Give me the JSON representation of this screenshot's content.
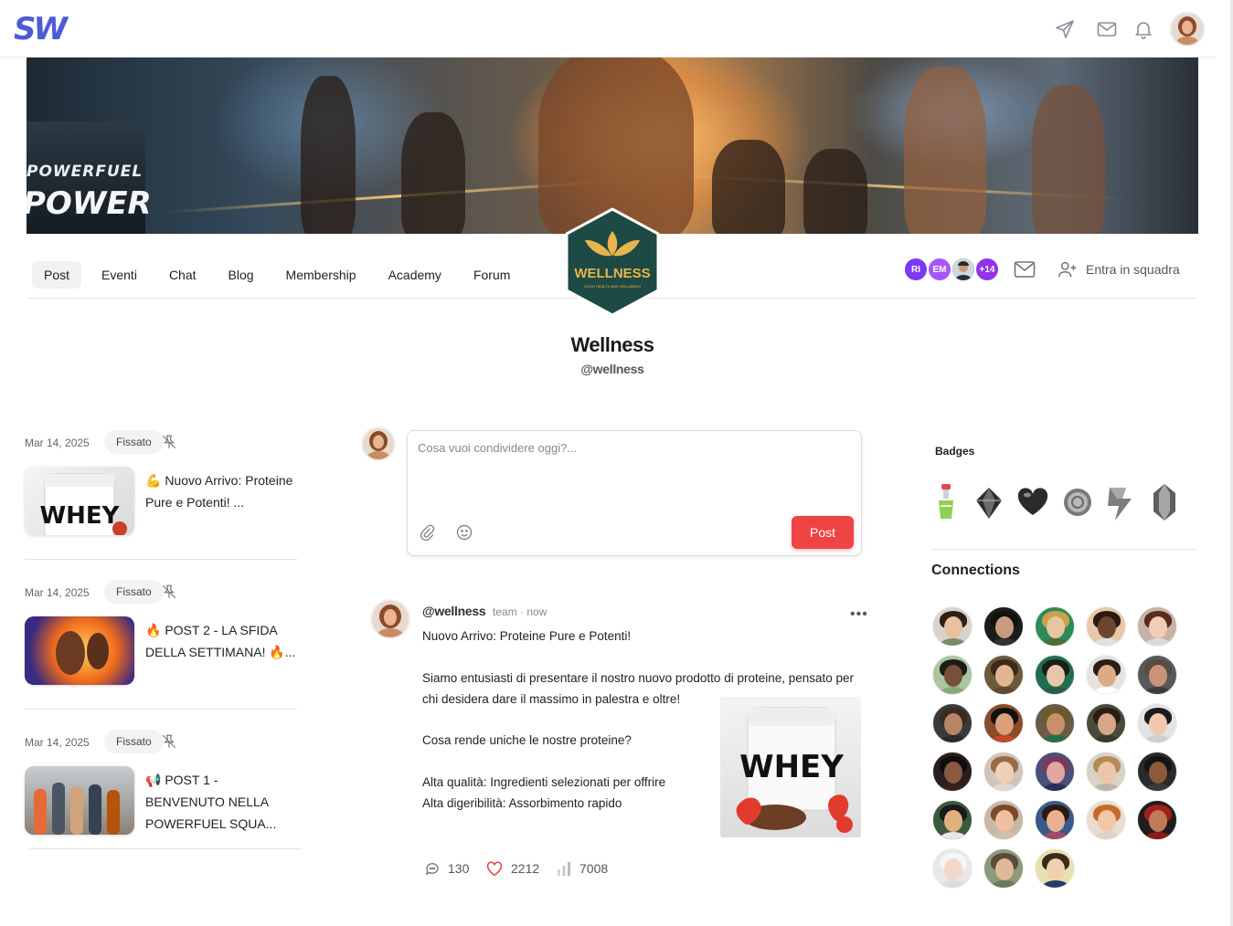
{
  "brand": {
    "logo_text": "SW"
  },
  "header": {
    "icons": [
      "paper-plane-icon",
      "mail-icon",
      "bell-icon"
    ],
    "accent": "#4f5bd5"
  },
  "banner": {
    "product_line1": "POWERFUEL",
    "product_line2": "POWER"
  },
  "tabs": [
    {
      "label": "Post",
      "active": true
    },
    {
      "label": "Eventi"
    },
    {
      "label": "Chat"
    },
    {
      "label": "Blog"
    },
    {
      "label": "Membership"
    },
    {
      "label": "Academy"
    },
    {
      "label": "Forum"
    }
  ],
  "team": {
    "logo_text": "WELLNESS",
    "logo_subtext": "GOOD HEALTH AND WELLBEING",
    "name": "Wellness",
    "handle": "@wellness",
    "logo_color": "#1e4a45"
  },
  "members": {
    "chips": [
      {
        "initials": "RI",
        "color": "#7c3aed"
      },
      {
        "initials": "EM",
        "color": "#a855f7"
      },
      {
        "initials": "",
        "color": "#3b3b3b"
      },
      {
        "initials": "+14",
        "color": "#9333ea"
      }
    ],
    "join_label": "Entra in squadra"
  },
  "pinned_posts": [
    {
      "date": "Mar 14, 2025",
      "badge": "Fissato",
      "title": "💪 Nuovo Arrivo: Proteine Pure e Potenti! ...",
      "thumb_label": "WHEY"
    },
    {
      "date": "Mar 14, 2025",
      "badge": "Fissato",
      "title": "🔥 POST 2 - LA SFIDA DELLA SETTIMANA! 🔥..."
    },
    {
      "date": "Mar 14, 2025",
      "badge": "Fissato",
      "title": "📢 POST 1 - BENVENUTO NELLA POWERFUEL SQUA..."
    }
  ],
  "composer": {
    "placeholder": "Cosa vuoi condividere oggi?...",
    "post_label": "Post",
    "post_color": "#ef4444"
  },
  "post": {
    "author": "@wellness",
    "meta": "team · now",
    "more": "•••",
    "lines": [
      "Nuovo Arrivo: Proteine Pure e Potenti!",
      "Siamo entusiasti di presentare il nostro nuovo prodotto di proteine, pensato per",
      "chi desidera dare il massimo in palestra e oltre!",
      "Cosa rende uniche le nostre proteine?",
      "Alta qualità: Ingredienti selezionati per offrire",
      "Alta digeribilità: Assorbimento rapido"
    ],
    "image_label": "WHEY",
    "comments": "130",
    "likes": "2212",
    "views": "7008"
  },
  "sidebar": {
    "badges_title": "Badges",
    "badge_icons": [
      "potion-badge-icon",
      "diamond-badge-icon",
      "heart-badge-icon",
      "coin-badge-icon",
      "bolt-badge-icon",
      "crystal-badge-icon"
    ],
    "connections_title": "Connections",
    "connection_count": 28
  }
}
